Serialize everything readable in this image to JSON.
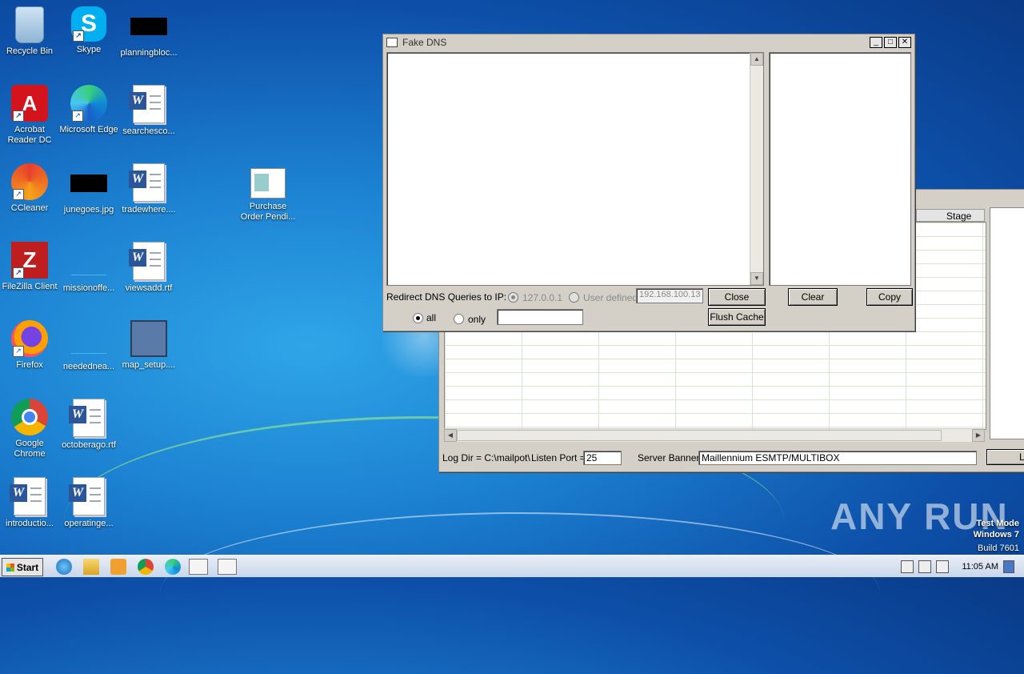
{
  "desktop": {
    "icons": [
      {
        "label": "Recycle Bin",
        "icon": "recycle-bin-icon"
      },
      {
        "label": "Skype",
        "icon": "skype-icon"
      },
      {
        "label": "planningbloc...",
        "icon": "black-thumbnail-icon"
      },
      {
        "label": "Acrobat Reader DC",
        "icon": "acrobat-icon"
      },
      {
        "label": "Microsoft Edge",
        "icon": "edge-icon"
      },
      {
        "label": "searchesco...",
        "icon": "word-doc-icon"
      },
      {
        "label": "CCleaner",
        "icon": "ccleaner-icon"
      },
      {
        "label": "junegoes.jpg",
        "icon": "black-thumbnail-icon"
      },
      {
        "label": "tradewhere....",
        "icon": "word-doc-icon"
      },
      {
        "label": "Purchase Order Pendi...",
        "icon": "document-icon"
      },
      {
        "label": "FileZilla Client",
        "icon": "filezilla-icon"
      },
      {
        "label": "missionoffe...",
        "icon": "blank-file-icon"
      },
      {
        "label": "viewsadd.rtf",
        "icon": "word-doc-icon"
      },
      {
        "label": "Firefox",
        "icon": "firefox-icon"
      },
      {
        "label": "needednea...",
        "icon": "blank-file-icon"
      },
      {
        "label": "map_setup....",
        "icon": "setup-icon"
      },
      {
        "label": "Google Chrome",
        "icon": "chrome-icon"
      },
      {
        "label": "octoberago.rtf",
        "icon": "word-doc-icon"
      },
      {
        "label": "introductio...",
        "icon": "word-doc-icon"
      },
      {
        "label": "operatinge...",
        "icon": "word-doc-icon"
      }
    ]
  },
  "fake_dns": {
    "title": "Fake DNS",
    "redirect_label": "Redirect DNS Queries to IP:",
    "radio_localhost": "127.0.0.1",
    "radio_user": "User defined",
    "ip_value": "192.168.100.13",
    "close_label": "Close",
    "flush_label": "Flush Cache",
    "clear_label": "Clear",
    "copy_label": "Copy",
    "radio_all": "all",
    "radio_only": "only",
    "only_value": ""
  },
  "mailpot": {
    "stage_header": "Stage",
    "logdir_label": "Log Dir = C:\\mailpot\\",
    "port_label": "Listen Port =",
    "port_value": "25",
    "banner_label": "Server Banner",
    "banner_value": "Maillennium ESMTP/MULTIBOX",
    "cut_button": "Li"
  },
  "taskbar": {
    "start_label": "Start",
    "clock": "11:05 AM"
  },
  "watermark": {
    "line1": "Test Mode",
    "line2": "Windows 7",
    "line3": "Build 7601",
    "brand": "ANY RUN"
  }
}
